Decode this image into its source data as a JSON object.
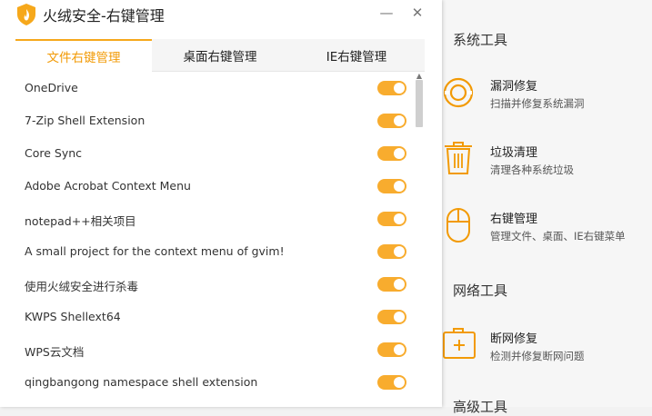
{
  "window": {
    "title": "火绒安全-右键管理",
    "minimize": "—",
    "close": "✕"
  },
  "tabs": [
    {
      "label": "文件右键管理",
      "active": true
    },
    {
      "label": "桌面右键管理",
      "active": false
    },
    {
      "label": "IE右键管理",
      "active": false
    }
  ],
  "items": [
    {
      "label": "OneDrive",
      "enabled": true
    },
    {
      "label": "7-Zip Shell Extension",
      "enabled": true
    },
    {
      "label": "Core Sync",
      "enabled": true
    },
    {
      "label": "Adobe Acrobat Context Menu",
      "enabled": true
    },
    {
      "label": "notepad++相关项目",
      "enabled": true
    },
    {
      "label": "A small project for the context menu of gvim!",
      "enabled": true
    },
    {
      "label": "使用火绒安全进行杀毒",
      "enabled": true
    },
    {
      "label": "KWPS Shellext64",
      "enabled": true
    },
    {
      "label": "WPS云文档",
      "enabled": true
    },
    {
      "label": "qingbangong namespace shell extension",
      "enabled": true
    }
  ],
  "tools_panel": {
    "system_title": "系统工具",
    "system_tools": [
      {
        "name": "漏洞修复",
        "desc": "扫描并修复系统漏洞",
        "icon": "vulnerability-repair-icon"
      },
      {
        "name": "垃圾清理",
        "desc": "清理各种系统垃圾",
        "icon": "trash-icon"
      },
      {
        "name": "右键管理",
        "desc": "管理文件、桌面、IE右键菜单",
        "icon": "mouse-icon"
      }
    ],
    "network_title": "网络工具",
    "network_tools": [
      {
        "name": "断网修复",
        "desc": "检测并修复断网问题",
        "icon": "first-aid-kit-icon"
      }
    ],
    "advanced_title": "高级工具"
  },
  "colors": {
    "accent": "#f6a81b",
    "toggle_on": "#f8ac2e",
    "icon_orange": "#f29a05"
  }
}
